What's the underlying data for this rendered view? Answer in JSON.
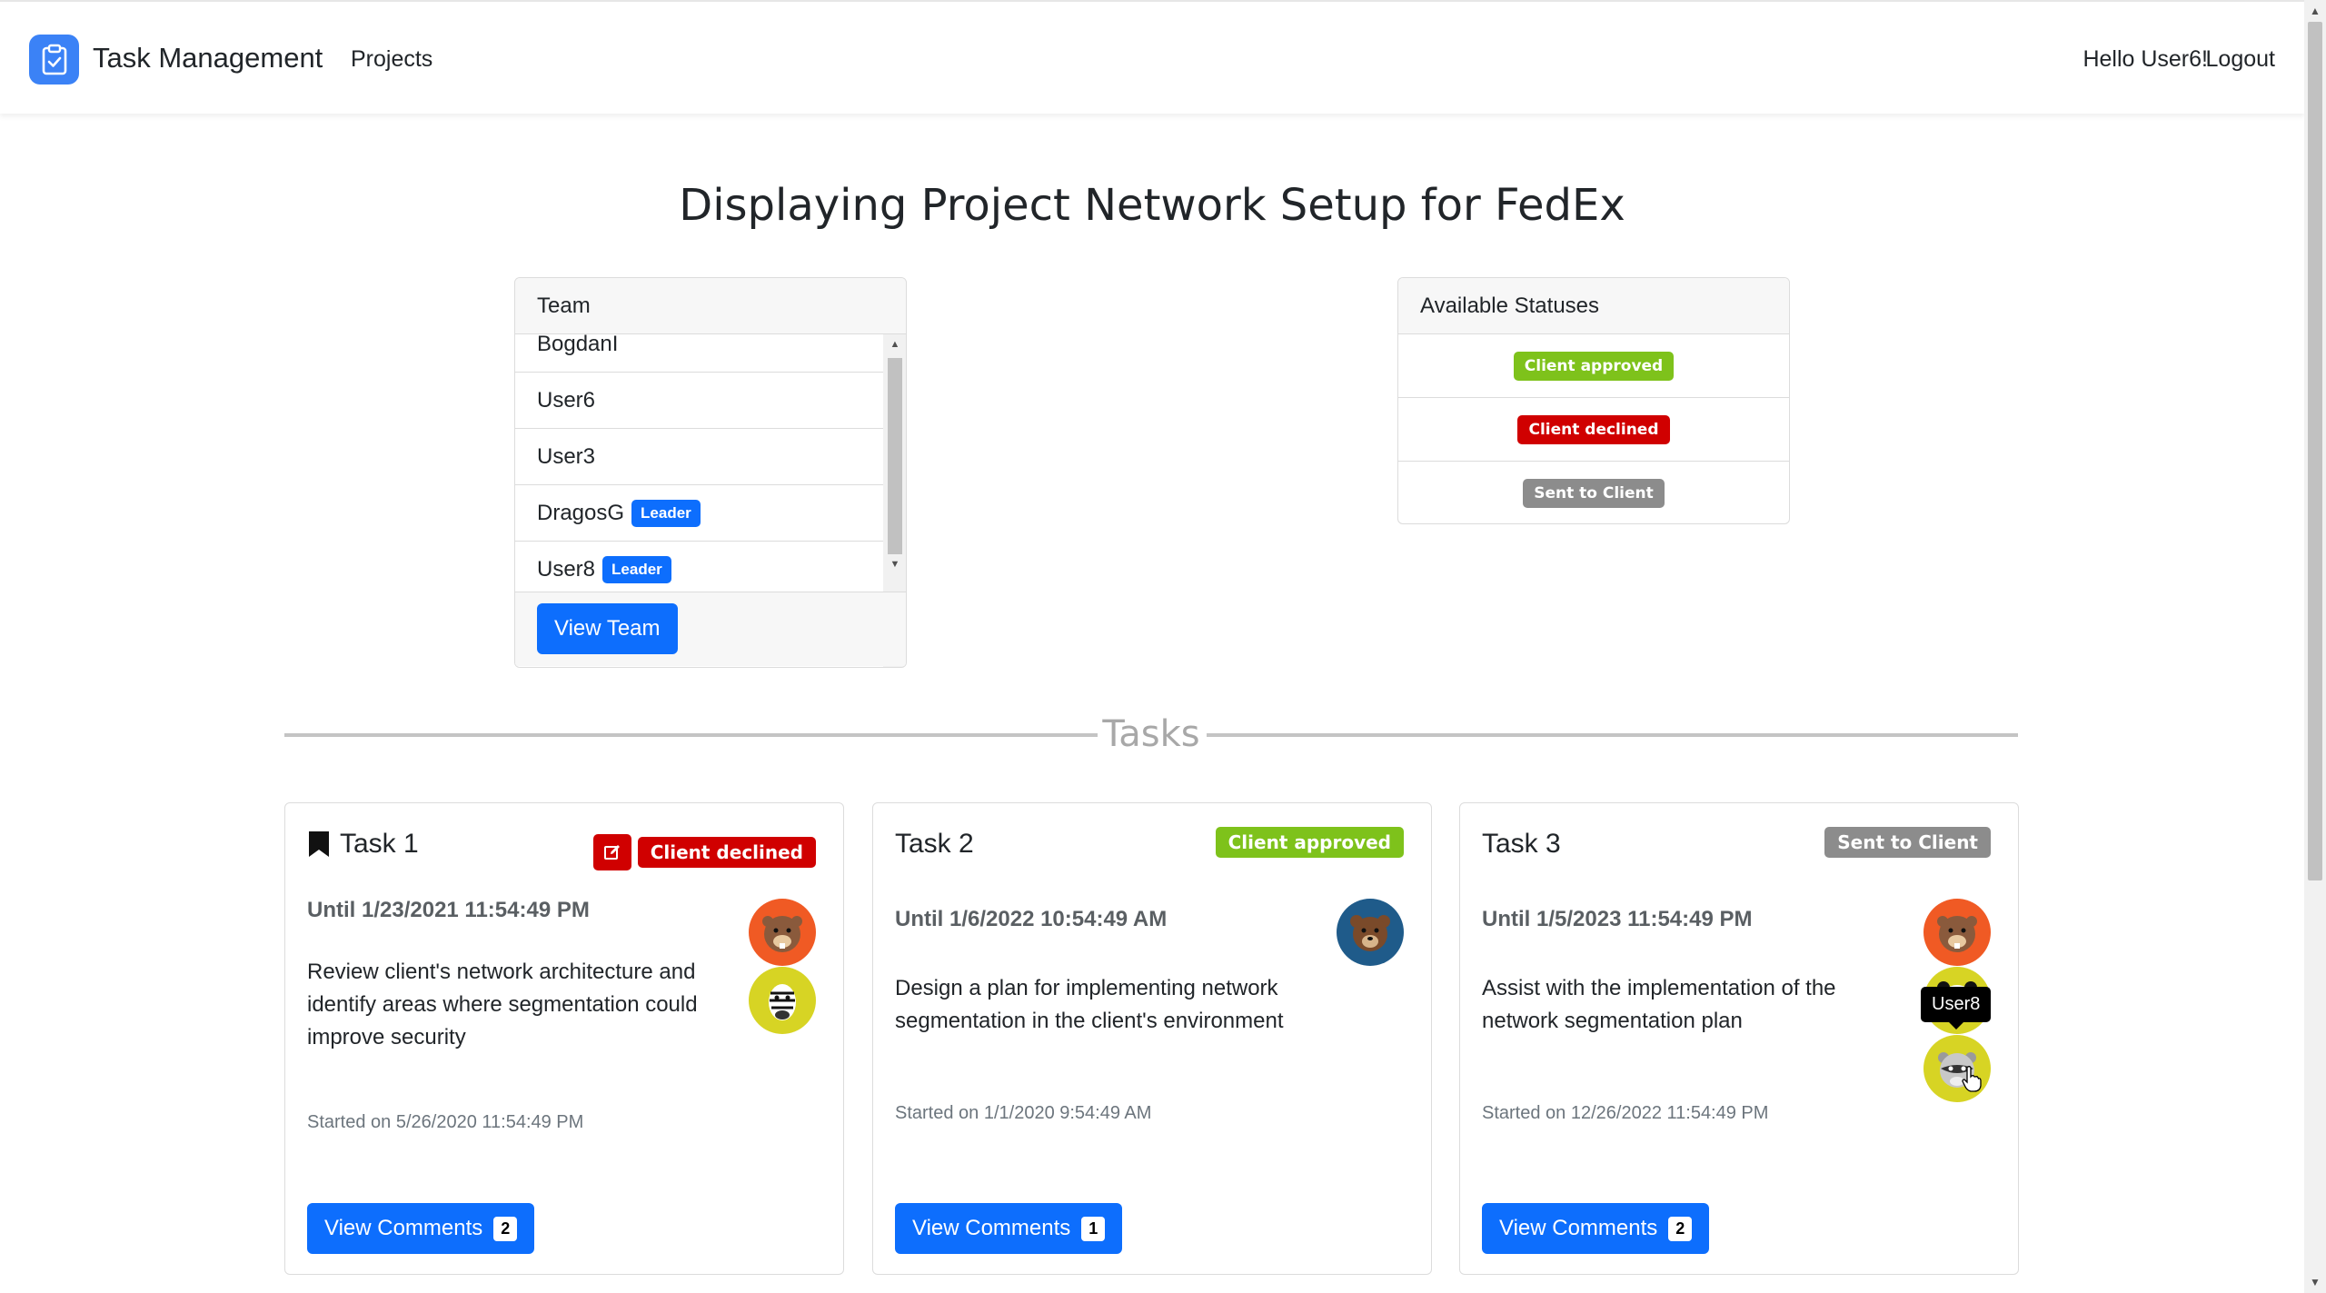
{
  "navbar": {
    "brand": "Task Management",
    "links": [
      "Projects"
    ],
    "greeting": "Hello User6!",
    "logout": "Logout"
  },
  "page": {
    "title": "Displaying Project Network Setup for FedEx"
  },
  "team": {
    "header": "Team",
    "members": [
      {
        "name": "BogdanI",
        "badge": ""
      },
      {
        "name": "User6",
        "badge": ""
      },
      {
        "name": "User3",
        "badge": ""
      },
      {
        "name": "DragosG",
        "badge": "Leader"
      },
      {
        "name": "User8",
        "badge": "Leader"
      }
    ],
    "button": "View Team"
  },
  "statuses": {
    "header": "Available Statuses",
    "items": [
      {
        "label": "Client approved",
        "color": "#7ec21b"
      },
      {
        "label": "Client declined",
        "color": "#d00000"
      },
      {
        "label": "Sent to Client",
        "color": "#8c8c8c"
      }
    ]
  },
  "tasks_divider": "Tasks",
  "tasks": [
    {
      "title": "Task 1",
      "icon": "bookmark-icon",
      "status": "Client declined",
      "status_color": "#d00000",
      "editable": true,
      "until": "Until 1/23/2021 11:54:49 PM",
      "description": "Review client's network architecture and identify areas where segmentation could improve security",
      "started": "Started on 5/26/2020 11:54:49 PM",
      "comments_label": "View Comments",
      "comments_count": "2",
      "assignees": [
        "beaver-avatar",
        "zebra-avatar"
      ]
    },
    {
      "title": "Task 2",
      "status": "Client approved",
      "status_color": "#7ec21b",
      "until": "Until 1/6/2022 10:54:49 AM",
      "description": "Design a plan for implementing network segmentation in the client's environment",
      "started": "Started on 1/1/2020 9:54:49 AM",
      "comments_label": "View Comments",
      "comments_count": "1",
      "assignees": [
        "bear-avatar"
      ]
    },
    {
      "title": "Task 3",
      "status": "Sent to Client",
      "status_color": "#8c8c8c",
      "until": "Until 1/5/2023 11:54:49 PM",
      "description": "Assist with the implementation of the network segmentation plan",
      "started": "Started on 12/26/2022 11:54:49 PM",
      "comments_label": "View Comments",
      "comments_count": "2",
      "assignees": [
        "beaver-avatar",
        "panda-avatar",
        "raccoon-avatar"
      ],
      "tooltip": "User8"
    }
  ]
}
